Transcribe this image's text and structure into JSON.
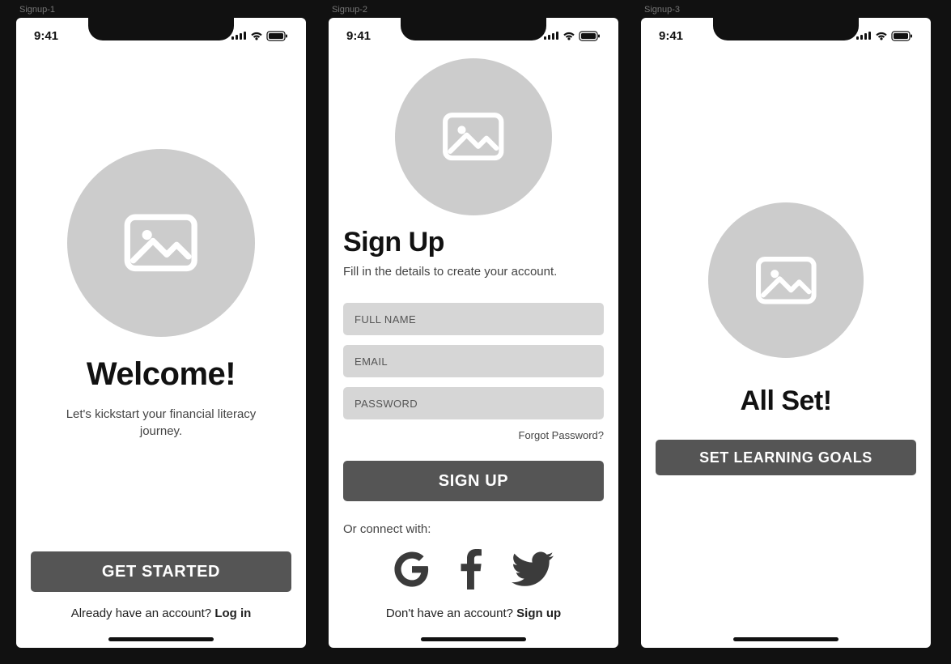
{
  "status": {
    "time": "9:41"
  },
  "frames": {
    "s1": {
      "label": "Signup-1",
      "title": "Welcome!",
      "subtitle": "Let's kickstart your financial literacy journey.",
      "cta": "GET STARTED",
      "footer_prefix": "Already have an account? ",
      "footer_action": "Log in"
    },
    "s2": {
      "label": "Signup-2",
      "title": "Sign Up",
      "subtitle": "Fill in the details to create your account.",
      "full_name_ph": "FULL NAME",
      "email_ph": "EMAIL",
      "password_ph": "PASSWORD",
      "forgot": "Forgot Password?",
      "cta": "SIGN UP",
      "connect": "Or connect with:",
      "footer_prefix": "Don't have an account? ",
      "footer_action": "Sign up"
    },
    "s3": {
      "label": "Signup-3",
      "title": "All Set!",
      "cta": "SET LEARNING GOALS"
    }
  }
}
